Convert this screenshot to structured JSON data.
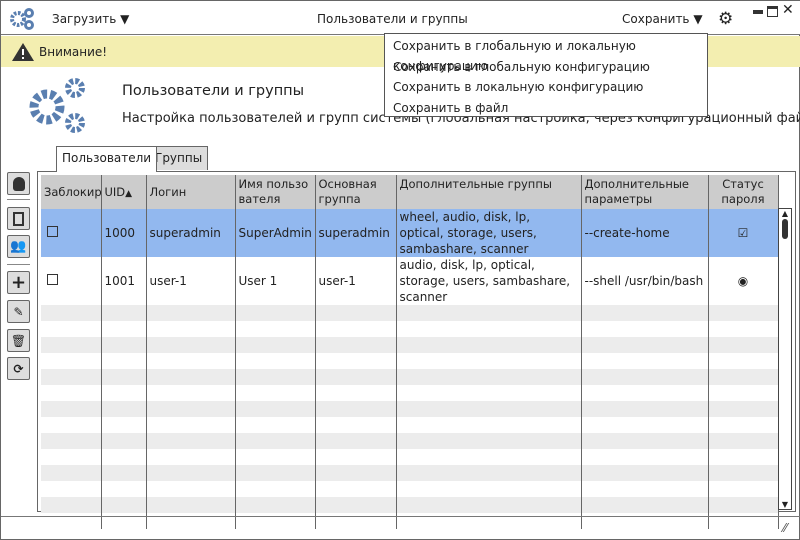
{
  "titlebar": {
    "load_label": "Загрузить",
    "title": "Пользователи и группы",
    "save_label": "Сохранить"
  },
  "warning": {
    "text": "Внимание!"
  },
  "save_menu": [
    "Сохранить в глобальную и локальную конфигурацию",
    "Сохранить в глобальную конфигурацию",
    "Сохранить в локальную конфигурацию",
    "Сохранить в файл"
  ],
  "header": {
    "title": "Пользователи и группы",
    "subtitle": "Настройка пользователей и групп системы (глобальная настройка, через конфигурационный файл)"
  },
  "tabs": [
    "Пользователи",
    "Группы"
  ],
  "table": {
    "columns": [
      "Заблокир",
      "UID",
      "Логин",
      "Имя пользователя",
      "Основная группа",
      "Дополнительные группы",
      "Дополнительные параметры",
      "Статус пароля"
    ],
    "rows": [
      {
        "locked": false,
        "uid": "1000",
        "login": "superadmin",
        "name": "SuperAdmin",
        "group": "superadmin",
        "extra_groups": "wheel, audio, disk, lp, optical, storage, users, sambashare, scanner",
        "params": "--create-home",
        "password_status": "checked"
      },
      {
        "locked": false,
        "uid": "1001",
        "login": "user-1",
        "name": "User 1",
        "group": "user-1",
        "extra_groups": "audio, disk, lp, optical, storage, users, sambashare, scanner",
        "params": "--shell /usr/bin/bash",
        "password_status": "radio"
      }
    ],
    "sort": {
      "column": "UID",
      "direction": "ascending"
    }
  },
  "colors": {
    "accent": "#5a7fb0",
    "selection": "#92b8ef",
    "warning": "#f3eeb0"
  }
}
